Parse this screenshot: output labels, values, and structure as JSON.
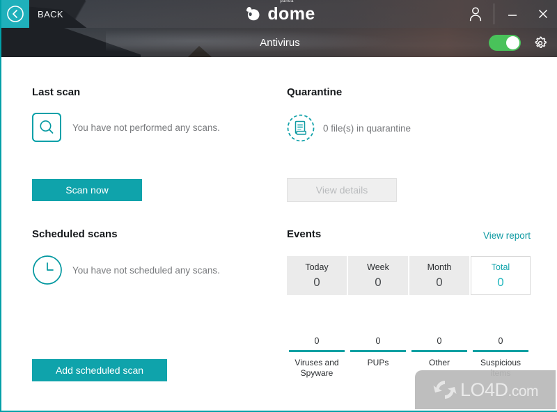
{
  "window": {
    "back_label": "BACK",
    "logo_text": "dome",
    "logo_sup": "panda",
    "page_title": "Antivirus",
    "accent_color": "#00a0a8",
    "toggle_on_color": "#49c25a",
    "toggle_state": "on",
    "controls": {
      "account": "account-icon",
      "minimize": "minimize-icon",
      "close": "close-icon",
      "settings": "gear-icon",
      "protection_toggle": "protection-toggle"
    }
  },
  "last_scan": {
    "title": "Last scan",
    "icon": "magnifier-icon",
    "status": "You have not performed any scans.",
    "button": "Scan now"
  },
  "quarantine": {
    "title": "Quarantine",
    "icon": "documents-icon",
    "status": "0 file(s) in quarantine",
    "button": "View details",
    "button_enabled": false
  },
  "scheduled_scans": {
    "title": "Scheduled scans",
    "icon": "clock-icon",
    "status": "You have not scheduled any scans.",
    "button": "Add scheduled scan"
  },
  "events": {
    "title": "Events",
    "report_link": "View report",
    "tabs": [
      {
        "label": "Today",
        "value": "0",
        "active": false
      },
      {
        "label": "Week",
        "value": "0",
        "active": false
      },
      {
        "label": "Month",
        "value": "0",
        "active": false
      },
      {
        "label": "Total",
        "value": "0",
        "active": true
      }
    ],
    "stats": [
      {
        "value": "0",
        "label": "Viruses and Spyware"
      },
      {
        "value": "0",
        "label": "PUPs"
      },
      {
        "value": "0",
        "label": "Other"
      },
      {
        "value": "0",
        "label": "Suspicious items"
      }
    ]
  },
  "watermark": {
    "text": "LO4D",
    "suffix": ".com",
    "icon": "refresh-arrows-icon"
  }
}
